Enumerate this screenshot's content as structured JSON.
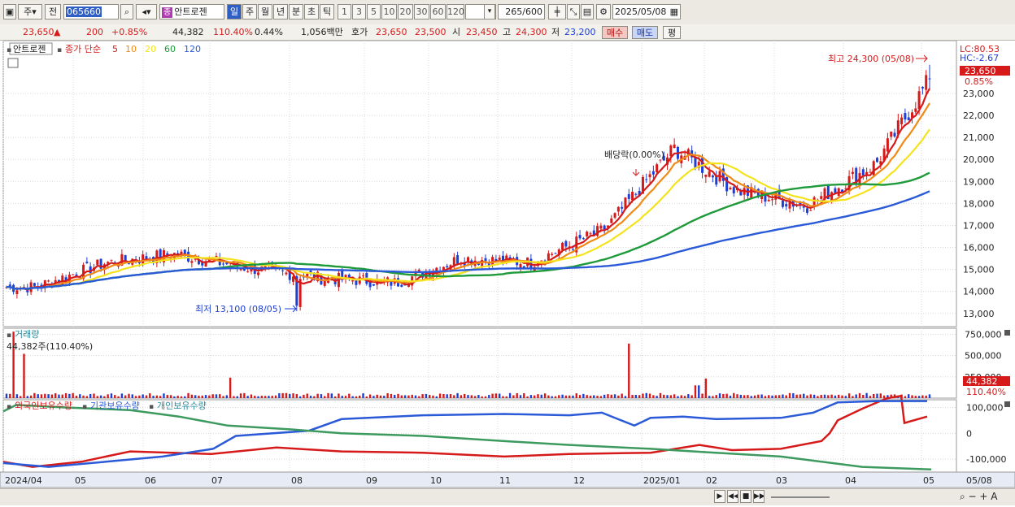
{
  "toolbar": {
    "market": "주",
    "prev_label": "전",
    "code": "065660",
    "stock_name_chip": "종",
    "stock_name": "안트로젠",
    "period_tabs": [
      "일",
      "주",
      "월",
      "년",
      "분",
      "초",
      "틱"
    ],
    "active_period": "일",
    "interval_buttons": [
      "1",
      "3",
      "5",
      "10",
      "20",
      "30",
      "60",
      "120"
    ],
    "count_value": "265",
    "count_total": "/600",
    "date_value": "2025/05/08"
  },
  "infobar": {
    "price": "23,650",
    "change_arrow": "▲",
    "change": "200",
    "change_pct": "+0.85%",
    "volume": "44,382",
    "volume_pct": "110.40%",
    "turnover": "0.44%",
    "amount": "1,056백만",
    "hoga_label": "호가",
    "ask": "23,650",
    "bid": "23,500",
    "open_label": "시",
    "open": "23,450",
    "high_label": "고",
    "high": "24,300",
    "low_label": "저",
    "low": "23,200",
    "buy_label": "매수",
    "sell_label": "매도",
    "eval_label": "평"
  },
  "colors": {
    "up": "#d61a1a",
    "down": "#1d3fd6",
    "ma5": "#d61a1a",
    "ma10": "#f08a16",
    "ma20": "#f4e31c",
    "ma60": "#1e9a3a",
    "ma120": "#2a5ad8",
    "foreign": "#d61a1a",
    "institution": "#2a5ad8",
    "individual": "#3d9a5e"
  },
  "price_panel": {
    "stock_label": "안트로젠",
    "legend_prefix": "종가 단순",
    "ma_labels": [
      "5",
      "10",
      "20",
      "60",
      "120"
    ],
    "lc_label": "LC:80.53",
    "hc_label": "HC:-2.67",
    "current_tag": "23,650",
    "current_pct_tag": "0.85%",
    "high_annotation": "최고 24,300 (05/08)",
    "low_annotation": "최저 13,100 (08/05)",
    "dividend_annotation": "배당락(0.00%)"
  },
  "volume_panel": {
    "title": "거래량",
    "current_text": "44,382주(110.40%)",
    "current_tag": "44,382",
    "pct_tag": "110.40%"
  },
  "holdings_panel": {
    "legend": [
      "외국인보유수량",
      "기관보유수량",
      "개인보유수량"
    ]
  },
  "chart_data": [
    {
      "type": "candlestick",
      "name": "price",
      "x_ticks": [
        "2024/04",
        "05",
        "06",
        "07",
        "08",
        "09",
        "10",
        "11",
        "12",
        "2025/01",
        "02",
        "03",
        "04",
        "05",
        "05/08"
      ],
      "y_ticks": [
        13000,
        14000,
        15000,
        16000,
        17000,
        18000,
        19000,
        20000,
        21000,
        22000,
        23000
      ],
      "ylim": [
        12400,
        25400
      ],
      "monthly_close": {
        "months": [
          "2024/04",
          "05",
          "06",
          "07",
          "08",
          "09",
          "10",
          "11",
          "12",
          "2025/01",
          "02",
          "03",
          "04",
          "05"
        ],
        "close": [
          14200,
          15300,
          15700,
          15100,
          14600,
          14400,
          15500,
          15300,
          16800,
          20500,
          18600,
          17900,
          19800,
          23650
        ]
      },
      "high": 24300,
      "low": 13100,
      "last_close": 23650
    },
    {
      "type": "bar",
      "name": "volume",
      "y_ticks": [
        250000,
        500000,
        750000
      ],
      "last_value": 44382
    },
    {
      "type": "line",
      "name": "holdings",
      "y_ticks": [
        -100000,
        0,
        100000
      ],
      "series_names": [
        "외국인보유수량",
        "기관보유수량",
        "개인보유수량"
      ]
    }
  ]
}
